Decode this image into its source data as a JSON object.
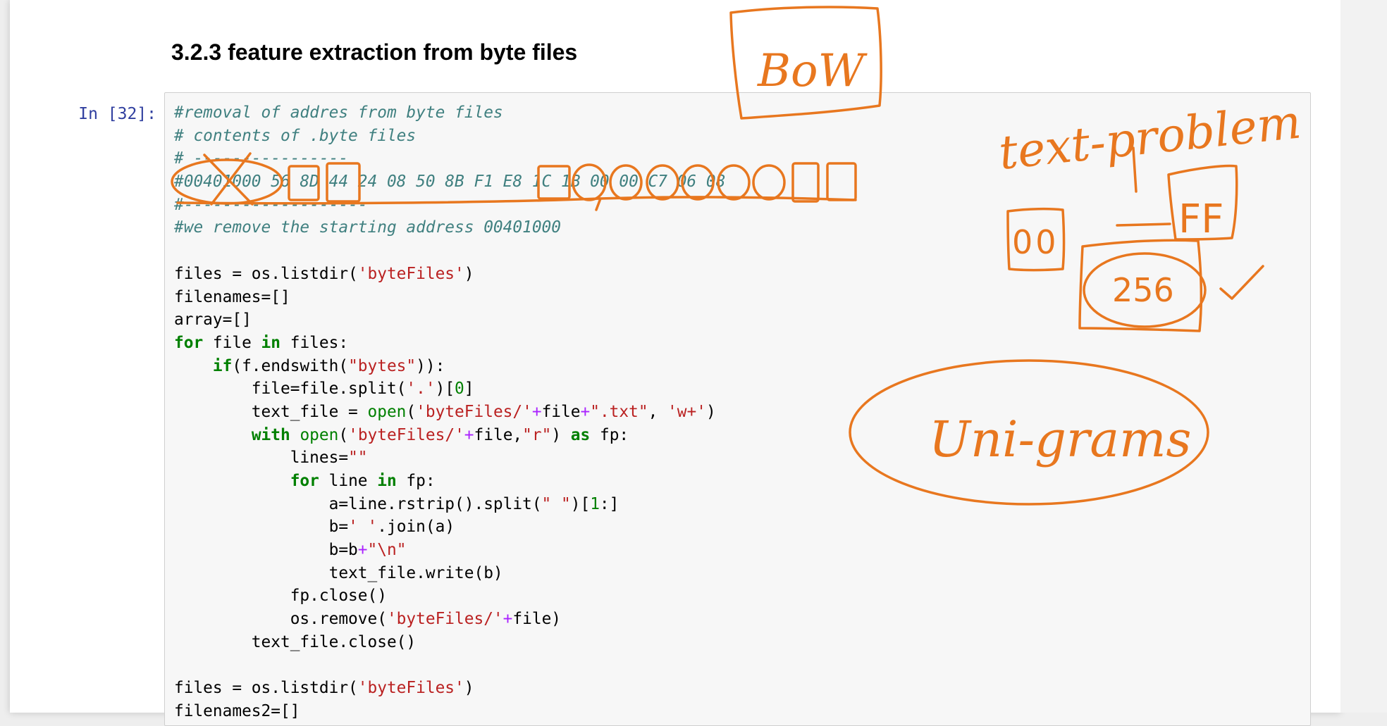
{
  "notebook": {
    "heading": "3.2.3 feature extraction from byte files",
    "cell": {
      "prompt": "In [32]:",
      "lines": [
        [
          {
            "t": "#removal of addres from byte files",
            "c": "c"
          }
        ],
        [
          {
            "t": "# contents of .byte files",
            "c": "c"
          }
        ],
        [
          {
            "t": "# ----------------",
            "c": "c"
          }
        ],
        [
          {
            "t": "#00401000 56 8D 44 24 08 50 8B F1 E8 1C 1B 00 00 C7 06 08",
            "c": "c"
          }
        ],
        [
          {
            "t": "#-------------------",
            "c": "c"
          }
        ],
        [
          {
            "t": "#we remove the starting address 00401000",
            "c": "c"
          }
        ],
        [
          {
            "t": "",
            "c": ""
          }
        ],
        [
          {
            "t": "files = os.listdir(",
            "c": ""
          },
          {
            "t": "'byteFiles'",
            "c": "s"
          },
          {
            "t": ")",
            "c": ""
          }
        ],
        [
          {
            "t": "filenames=[]",
            "c": ""
          }
        ],
        [
          {
            "t": "array=[]",
            "c": ""
          }
        ],
        [
          {
            "t": "for",
            "c": "k"
          },
          {
            "t": " file ",
            "c": ""
          },
          {
            "t": "in",
            "c": "k"
          },
          {
            "t": " files:",
            "c": ""
          }
        ],
        [
          {
            "t": "    ",
            "c": ""
          },
          {
            "t": "if",
            "c": "k"
          },
          {
            "t": "(f.endswith(",
            "c": ""
          },
          {
            "t": "\"bytes\"",
            "c": "s"
          },
          {
            "t": ")):",
            "c": ""
          }
        ],
        [
          {
            "t": "        file=file.split(",
            "c": ""
          },
          {
            "t": "'.'",
            "c": "s"
          },
          {
            "t": ")[",
            "c": ""
          },
          {
            "t": "0",
            "c": "n"
          },
          {
            "t": "]",
            "c": ""
          }
        ],
        [
          {
            "t": "        text_file = ",
            "c": ""
          },
          {
            "t": "open",
            "c": "b"
          },
          {
            "t": "(",
            "c": ""
          },
          {
            "t": "'byteFiles/'",
            "c": "s"
          },
          {
            "t": "+",
            "c": "o"
          },
          {
            "t": "file",
            "c": ""
          },
          {
            "t": "+",
            "c": "o"
          },
          {
            "t": "\".txt\"",
            "c": "s"
          },
          {
            "t": ", ",
            "c": ""
          },
          {
            "t": "'w+'",
            "c": "s"
          },
          {
            "t": ")",
            "c": ""
          }
        ],
        [
          {
            "t": "        ",
            "c": ""
          },
          {
            "t": "with",
            "c": "k"
          },
          {
            "t": " ",
            "c": ""
          },
          {
            "t": "open",
            "c": "b"
          },
          {
            "t": "(",
            "c": ""
          },
          {
            "t": "'byteFiles/'",
            "c": "s"
          },
          {
            "t": "+",
            "c": "o"
          },
          {
            "t": "file,",
            "c": ""
          },
          {
            "t": "\"r\"",
            "c": "s"
          },
          {
            "t": ") ",
            "c": ""
          },
          {
            "t": "as",
            "c": "k"
          },
          {
            "t": " fp:",
            "c": ""
          }
        ],
        [
          {
            "t": "            lines=",
            "c": ""
          },
          {
            "t": "\"\"",
            "c": "s"
          }
        ],
        [
          {
            "t": "            ",
            "c": ""
          },
          {
            "t": "for",
            "c": "k"
          },
          {
            "t": " line ",
            "c": ""
          },
          {
            "t": "in",
            "c": "k"
          },
          {
            "t": " fp:",
            "c": ""
          }
        ],
        [
          {
            "t": "                a=line.rstrip().split(",
            "c": ""
          },
          {
            "t": "\" \"",
            "c": "s"
          },
          {
            "t": ")[",
            "c": ""
          },
          {
            "t": "1",
            "c": "n"
          },
          {
            "t": ":]",
            "c": ""
          }
        ],
        [
          {
            "t": "                b=",
            "c": ""
          },
          {
            "t": "' '",
            "c": "s"
          },
          {
            "t": ".join(a)",
            "c": ""
          }
        ],
        [
          {
            "t": "                b=b",
            "c": ""
          },
          {
            "t": "+",
            "c": "o"
          },
          {
            "t": "\"\\n\"",
            "c": "s"
          }
        ],
        [
          {
            "t": "                text_file.write(b)",
            "c": ""
          }
        ],
        [
          {
            "t": "            fp.close()",
            "c": ""
          }
        ],
        [
          {
            "t": "            os.remove(",
            "c": ""
          },
          {
            "t": "'byteFiles/'",
            "c": "s"
          },
          {
            "t": "+",
            "c": "o"
          },
          {
            "t": "file)",
            "c": ""
          }
        ],
        [
          {
            "t": "        text_file.close()",
            "c": ""
          }
        ],
        [
          {
            "t": "",
            "c": ""
          }
        ],
        [
          {
            "t": "files = os.listdir(",
            "c": ""
          },
          {
            "t": "'byteFiles'",
            "c": "s"
          },
          {
            "t": ")",
            "c": ""
          }
        ],
        [
          {
            "t": "filenames2=[]",
            "c": ""
          }
        ]
      ]
    }
  },
  "annotations": {
    "ink_color": "#e8771f",
    "bow_label": "BoW",
    "text_problem_label": "text-problem",
    "hex_00_label": "00",
    "hex_ff_label": "FF",
    "count_256_label": "256",
    "ngrams_label": "Uni-grams"
  }
}
